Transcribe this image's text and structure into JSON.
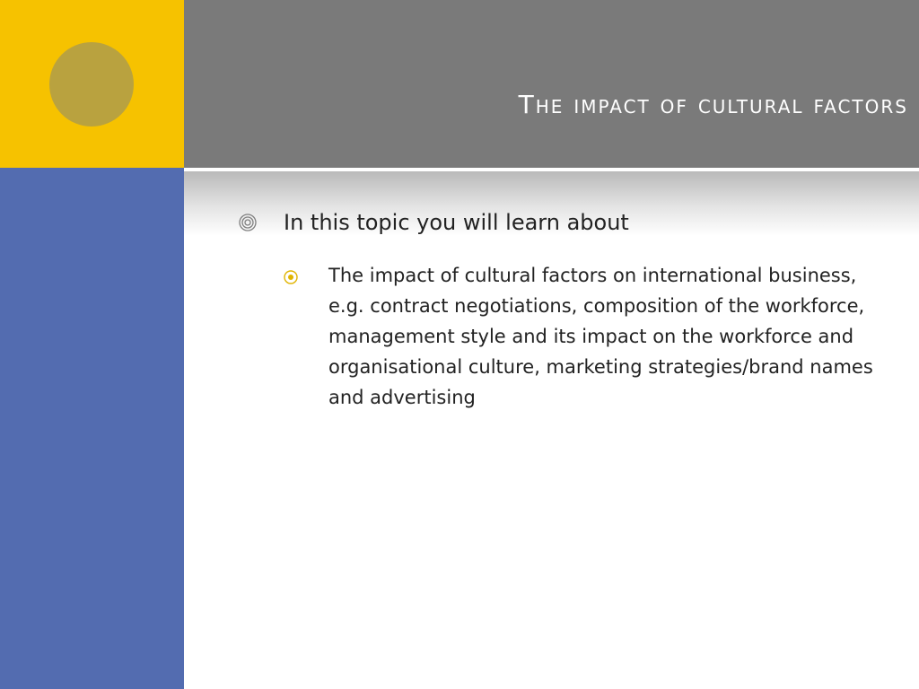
{
  "colors": {
    "yellow": "#f6c200",
    "circle": "#b9a23f",
    "blue": "#536cb0",
    "title_bar": "#7a7a7a",
    "bullet_l1": "#7f7f7f",
    "bullet_l2": "#e0b400"
  },
  "slide": {
    "title": "The impact of cultural factors",
    "bullets": [
      {
        "level": 1,
        "icon": "circle-target-icon",
        "text": "In this topic you will learn about"
      },
      {
        "level": 2,
        "icon": "circle-dot-icon",
        "text": "The impact of cultural factors on international business, e.g. contract negotiations, composition of the workforce, management style and its impact on the workforce  and organisational culture, marketing strategies/brand names and advertising"
      }
    ]
  }
}
